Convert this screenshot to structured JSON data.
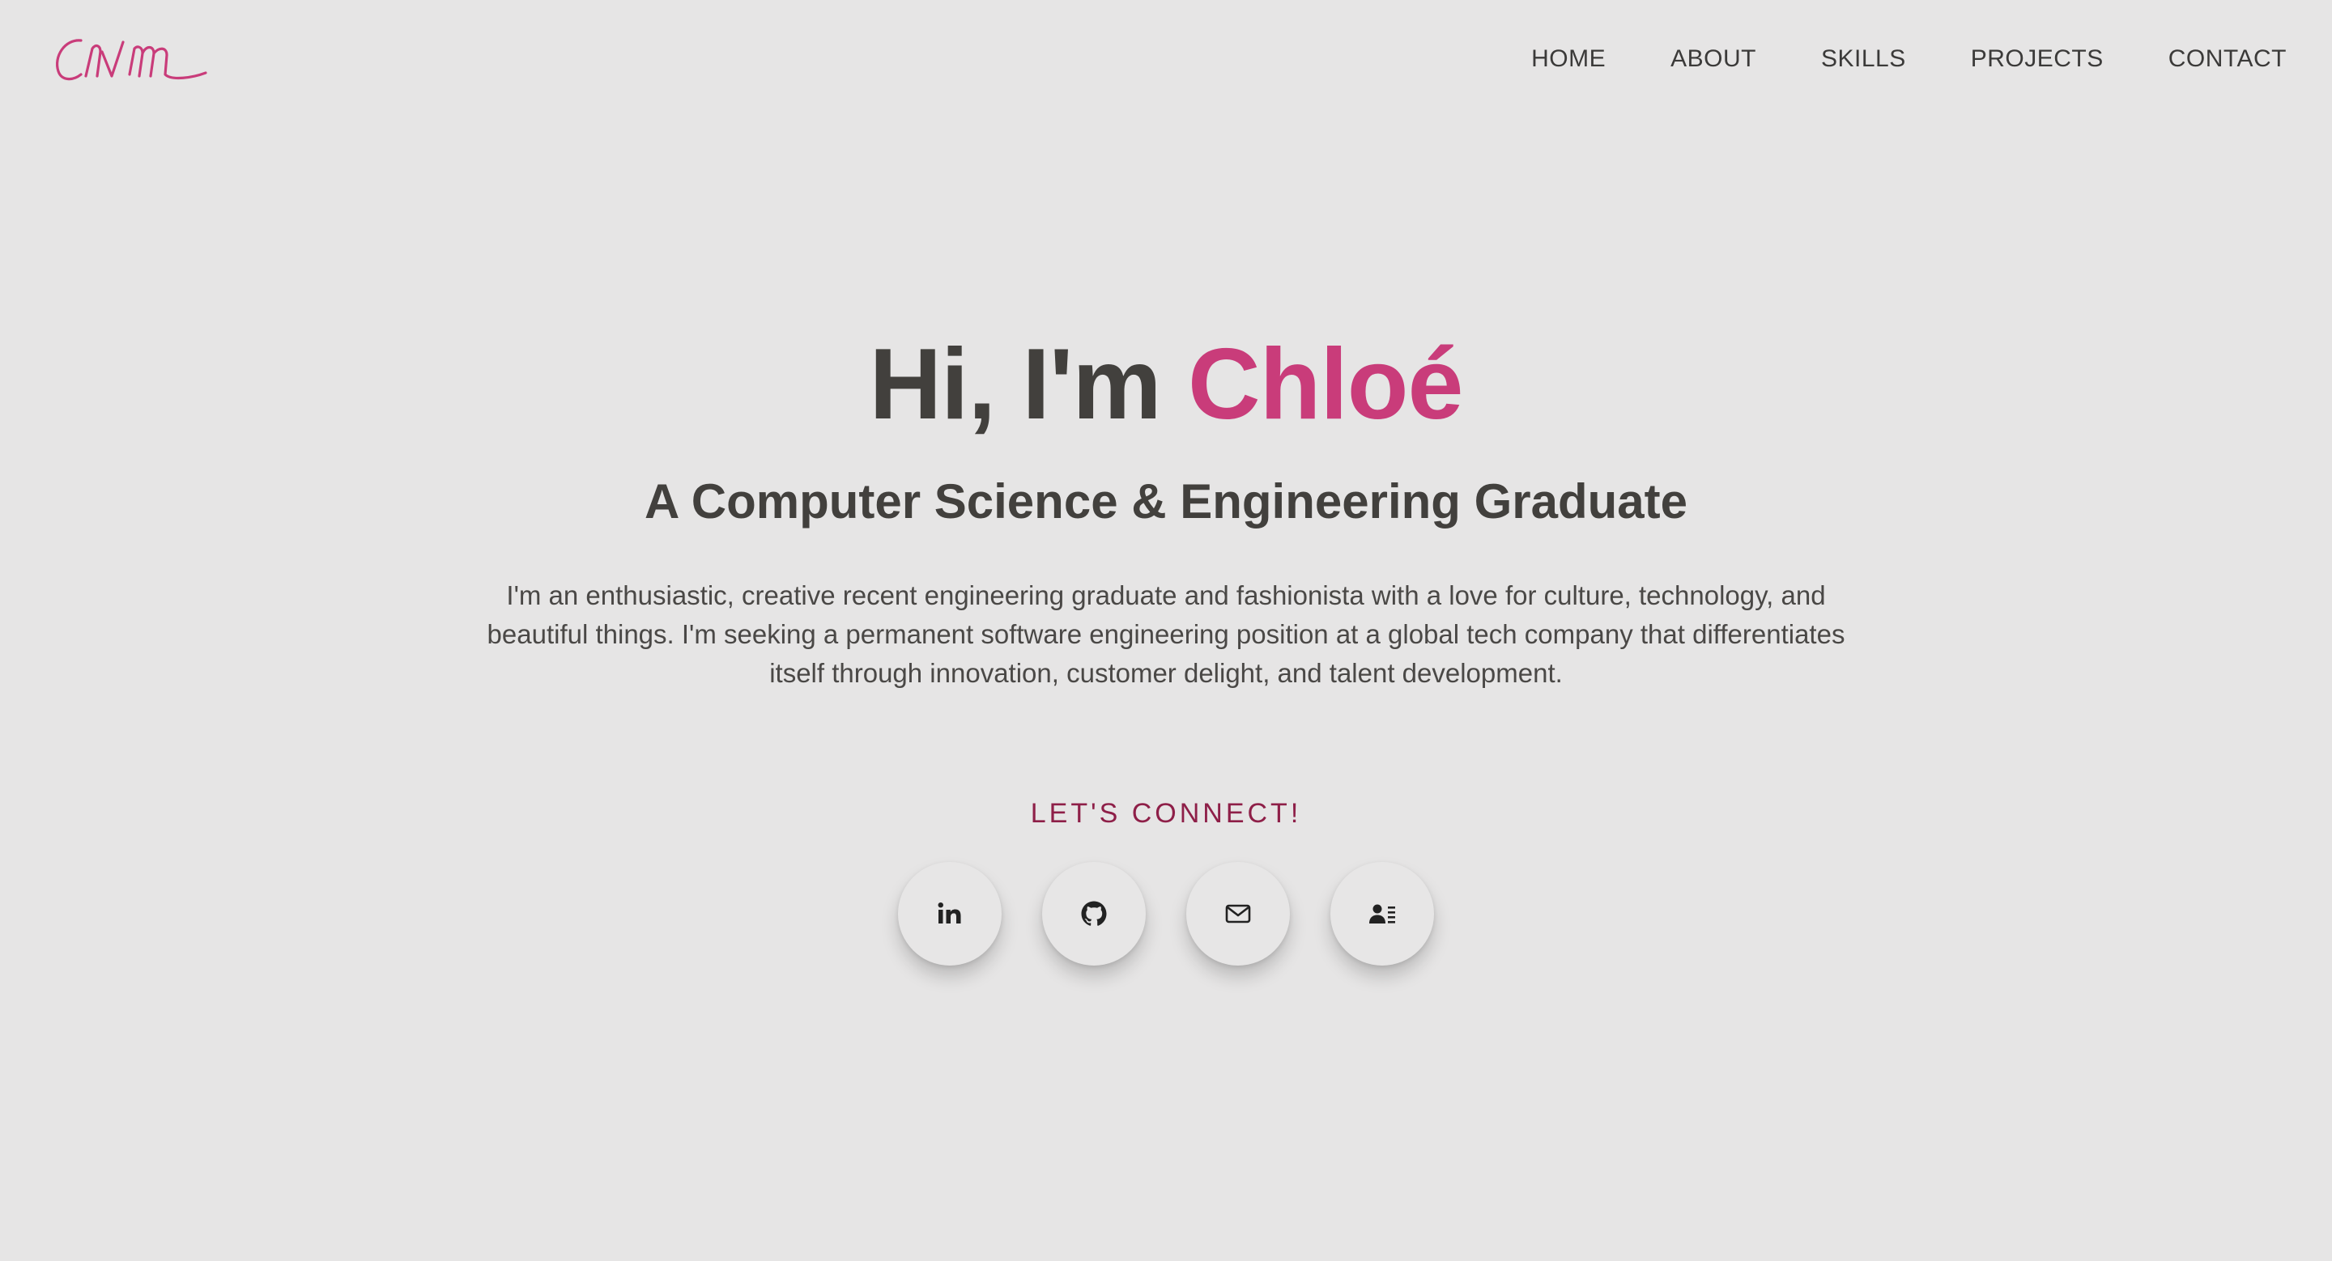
{
  "logo": {
    "text": "cnm",
    "color": "#c93c7a"
  },
  "nav": {
    "items": [
      {
        "label": "HOME"
      },
      {
        "label": "ABOUT"
      },
      {
        "label": "SKILLS"
      },
      {
        "label": "PROJECTS"
      },
      {
        "label": "CONTACT"
      }
    ]
  },
  "hero": {
    "greeting": "Hi, I'm ",
    "name": "Chloé",
    "subtitle": "A Computer Science & Engineering Graduate",
    "description": "I'm an enthusiastic, creative recent engineering graduate and fashionista with a love for culture, technology, and beautiful things. I'm seeking a permanent software engineering position at a global tech company that differentiates itself through innovation, customer delight, and talent development."
  },
  "connect": {
    "label": "LET'S CONNECT!",
    "links": [
      {
        "icon": "linkedin-icon"
      },
      {
        "icon": "github-icon"
      },
      {
        "icon": "mail-icon"
      },
      {
        "icon": "resume-icon"
      }
    ]
  },
  "colors": {
    "background": "#e6e5e5",
    "accent": "#c93c7a",
    "connect_label": "#8e1f48",
    "text": "#42403d"
  }
}
